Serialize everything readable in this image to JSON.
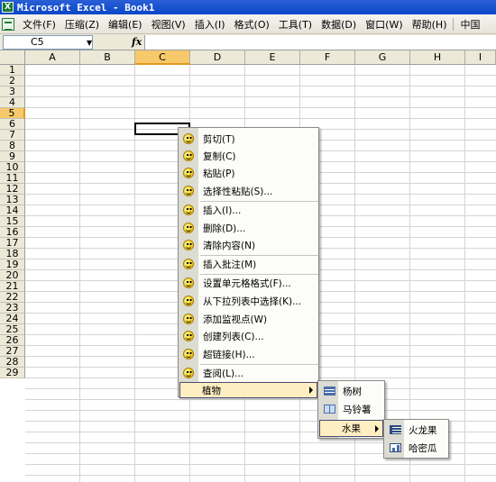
{
  "window": {
    "title": "Microsoft Excel - Book1",
    "icon": "excel-icon"
  },
  "menubar": {
    "items": [
      "文件(F)",
      "压缩(Z)",
      "编辑(E)",
      "视图(V)",
      "插入(I)",
      "格式(O)",
      "工具(T)",
      "数据(D)",
      "窗口(W)",
      "帮助(H)"
    ],
    "extra": "中国"
  },
  "formula_bar": {
    "name_box": "C5",
    "fx": "fx",
    "formula": ""
  },
  "grid": {
    "columns": [
      "A",
      "B",
      "C",
      "D",
      "E",
      "F",
      "G",
      "H",
      "I"
    ],
    "rows": [
      "1",
      "2",
      "3",
      "4",
      "5",
      "6",
      "7",
      "8",
      "9",
      "10",
      "11",
      "12",
      "13",
      "14",
      "15",
      "16",
      "17",
      "18",
      "19",
      "20",
      "21",
      "22",
      "23",
      "24",
      "25",
      "26",
      "27",
      "28",
      "29"
    ],
    "active_column": "C",
    "active_row": "5"
  },
  "context_menu": {
    "items": [
      {
        "label": "剪切(T)",
        "icon": "smiley-icon"
      },
      {
        "label": "复制(C)",
        "icon": "smiley-icon"
      },
      {
        "label": "粘贴(P)",
        "icon": "smiley-icon"
      },
      {
        "label": "选择性粘贴(S)...",
        "icon": "smiley-icon"
      },
      {
        "label": "插入(I)...",
        "icon": "smiley-icon"
      },
      {
        "label": "删除(D)...",
        "icon": "smiley-icon"
      },
      {
        "label": "清除内容(N)",
        "icon": "smiley-icon"
      },
      {
        "label": "插入批注(M)",
        "icon": "smiley-icon"
      },
      {
        "label": "设置单元格格式(F)...",
        "icon": "smiley-icon"
      },
      {
        "label": "从下拉列表中选择(K)...",
        "icon": "smiley-icon"
      },
      {
        "label": "添加监视点(W)",
        "icon": "smiley-icon"
      },
      {
        "label": "创建列表(C)...",
        "icon": "smiley-icon"
      },
      {
        "label": "超链接(H)...",
        "icon": "smiley-icon"
      },
      {
        "label": "查阅(L)...",
        "icon": "smiley-icon"
      }
    ],
    "submenu_label": "植物"
  },
  "submenu_plants": {
    "items": [
      {
        "label": "杨树",
        "icon": "list-icon"
      },
      {
        "label": "马铃薯",
        "icon": "table-icon"
      }
    ],
    "submenu_label": "水果"
  },
  "submenu_fruits": {
    "items": [
      {
        "label": "火龙果",
        "icon": "grid-icon"
      },
      {
        "label": "哈密瓜",
        "icon": "chart-icon"
      }
    ]
  }
}
